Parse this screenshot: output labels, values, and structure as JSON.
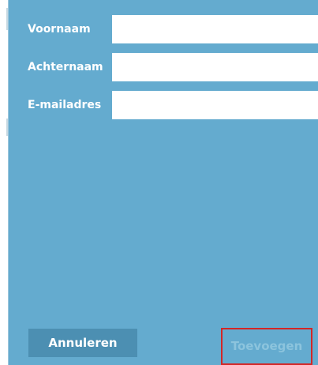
{
  "form": {
    "fields": [
      {
        "label": "Voornaam",
        "value": "",
        "placeholder": ""
      },
      {
        "label": "Achternaam",
        "value": "",
        "placeholder": ""
      },
      {
        "label": "E-mailadres",
        "value": "",
        "placeholder": ""
      }
    ]
  },
  "actions": {
    "cancel_label": "Annuleren",
    "add_label": "Toevoegen"
  },
  "colors": {
    "panel_background": "#64abcf",
    "cancel_button": "#4c8fb2",
    "add_button_text_disabled": "#8cc4dd",
    "focus_outline": "#d32626"
  }
}
